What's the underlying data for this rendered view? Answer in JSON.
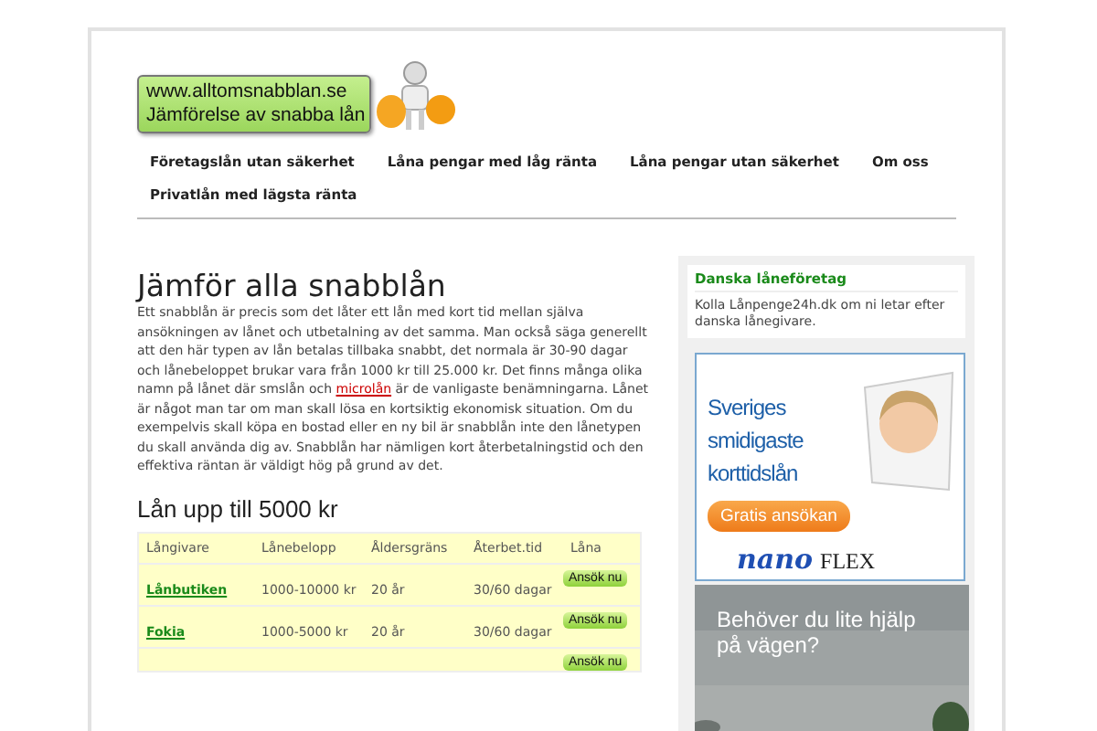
{
  "logo": {
    "lines": [
      "www.alltomsnabblan.se",
      "Jämförelse av snabba lån"
    ]
  },
  "nav": [
    {
      "label": "Företagslån utan säkerhet"
    },
    {
      "label": "Låna pengar med låg ränta"
    },
    {
      "label": "Låna pengar utan säkerhet"
    },
    {
      "label": "Om oss"
    },
    {
      "label": "Privatlån med lägsta ränta"
    }
  ],
  "article": {
    "title": "Jämför alla snabblån",
    "body": "Ett snabblån är precis som det låter ett lån med kort tid mellan själva ansökningen av lånet och utbetalning av det samma. Man också säga generellt att den här typen av lån betalas tillbaka snabbt, det normala är 30-90 dagar och lånebeloppet brukar vara från 1000 kr till 25.000 kr. Det finns många olika namn på lånet där smslån och ",
    "link": "microlån",
    "body_end": " är de vanligaste benämningarna. Lånet är något man tar om man skall lösa en kortsiktig ekonomisk situation. Om du exempelvis skall köpa en bostad eller en ny bil är snabblån inte den lånetypen du skall använda dig av. Snabblån har nämligen kort återbetalningstid och den effektiva räntan är väldigt hög på grund av det."
  },
  "table": {
    "title": "Lån upp till 5000 kr",
    "columns": [
      "Långivare",
      "Lånebelopp",
      "Åldersgräns",
      "Återbet.tid",
      "Låna"
    ],
    "rows": [
      {
        "lender": "Lånbutiken",
        "amount": "1000-10000 kr",
        "age": "20 år",
        "term": "30/60 dagar",
        "button": "Ansök nu"
      },
      {
        "lender": "Fokia",
        "amount": "1000-5000 kr",
        "age": "20 år",
        "term": "30/60 dagar",
        "button": "Ansök nu"
      },
      {
        "button": "Ansök nu"
      }
    ]
  },
  "sidebar": {
    "widget": {
      "title": "Danska låneföretag",
      "text": "Kolla Lånpenge24h.dk om ni letar efter danska lånegivare."
    },
    "ad1": {
      "headline": [
        "Sveriges",
        "smidigaste",
        "korttidslån"
      ],
      "button": "Gratis ansökan",
      "brand": "nano",
      "brand2": "FLEX"
    },
    "ad2": {
      "kind": "picture",
      "text": "Behöver du lite hjälp på vägen?"
    }
  }
}
